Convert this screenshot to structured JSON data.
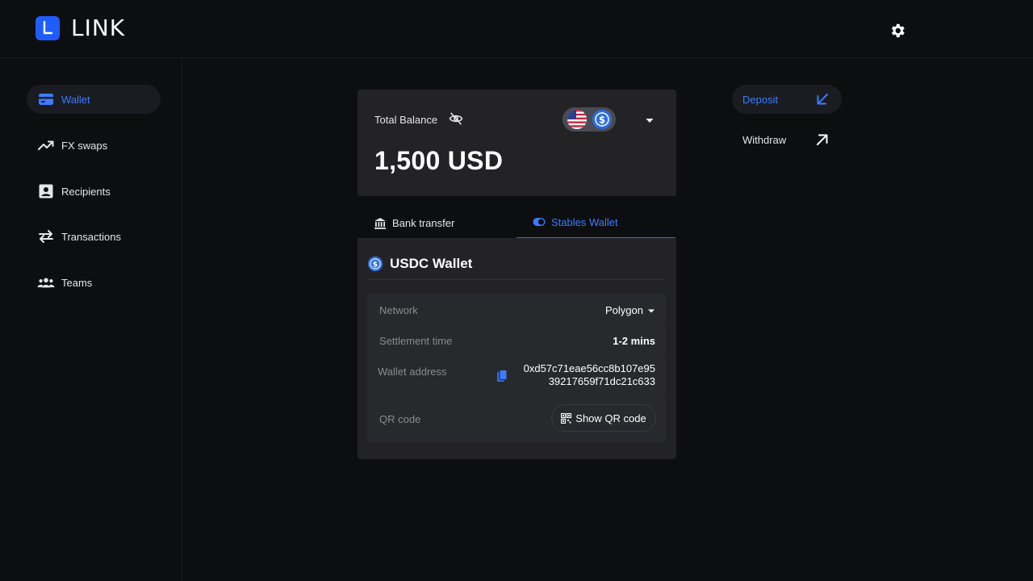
{
  "app": {
    "name": "LINK"
  },
  "sidebar": {
    "items": [
      {
        "label": "Wallet",
        "icon": "wallet-icon",
        "active": true
      },
      {
        "label": "FX swaps",
        "icon": "trending-up-icon"
      },
      {
        "label": "Recipients",
        "icon": "contact-icon"
      },
      {
        "label": "Transactions",
        "icon": "swap-arrows-icon"
      },
      {
        "label": "Teams",
        "icon": "people-icon"
      }
    ]
  },
  "balance": {
    "label": "Total Balance",
    "amount": "1,500 USD",
    "currencies": [
      "us-flag-icon",
      "usdc-icon"
    ]
  },
  "tabs": [
    {
      "label": "Bank transfer",
      "icon": "bank-icon",
      "active": false
    },
    {
      "label": "Stables Wallet",
      "icon": "toggle-icon",
      "active": true
    }
  ],
  "wallet": {
    "title": "USDC Wallet",
    "network_label": "Network",
    "network_value": "Polygon",
    "settlement_label": "Settlement time",
    "settlement_value": "1-2 mins",
    "address_label": "Wallet address",
    "address_line1": "0xd57c71eae56cc8b107e95",
    "address_line2": "39217659f71dc21c633",
    "qr_label": "QR code",
    "qr_button": "Show QR code"
  },
  "actions": {
    "deposit": "Deposit",
    "withdraw": "Withdraw"
  },
  "colors": {
    "background": "#0d0e10",
    "card": "#232325",
    "accent": "#2a6cff",
    "active_text": "#3d7bff"
  }
}
